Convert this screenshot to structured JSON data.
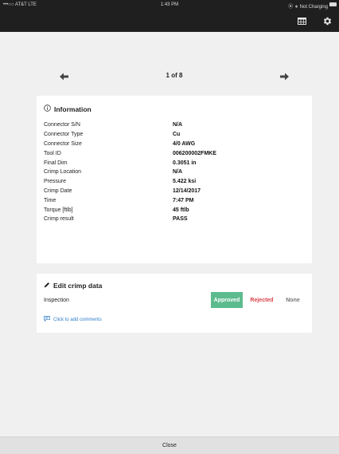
{
  "statusbar": {
    "carrier": "•••○○ AT&T  LTE",
    "time": "1:43 PM",
    "battery_status": "⦿ ∗ Not Charging"
  },
  "navbar": {
    "icons": [
      "table-icon",
      "gear-icon"
    ]
  },
  "pager": {
    "count": "1 of 8"
  },
  "info": {
    "title": "Information",
    "rows": [
      {
        "key": "Connector S/N",
        "value": "N/A"
      },
      {
        "key": "Connector Type",
        "value": "Cu"
      },
      {
        "key": "Connector Size",
        "value": "4/0 AWG"
      },
      {
        "key": "Tool ID",
        "value": "006200002FMKE"
      },
      {
        "key": "Final Dim",
        "value": "0.3051 in"
      },
      {
        "key": "Crimp Location",
        "value": "N/A"
      },
      {
        "key": "Pressure",
        "value": "5.422 ksi"
      },
      {
        "key": "Crimp Date",
        "value": "12/14/2017"
      },
      {
        "key": "Time",
        "value": "7:47 PM"
      },
      {
        "key": "Torque [ftlb]",
        "value": "45 ftlb"
      },
      {
        "key": "Crimp result",
        "value": "PASS"
      }
    ]
  },
  "edit": {
    "title": "Edit crimp data",
    "inspection_label": "Inspection",
    "options": {
      "approved": "Approved",
      "rejected": "Rejected",
      "none": "None"
    },
    "selected": "approved",
    "comments_link": "Click to add comments"
  },
  "footer": {
    "close_label": "Close"
  },
  "colors": {
    "approved": "#5dbb8d",
    "rejected": "#d9434a",
    "link": "#2f7ec9",
    "bar": "#1f1f1f"
  }
}
